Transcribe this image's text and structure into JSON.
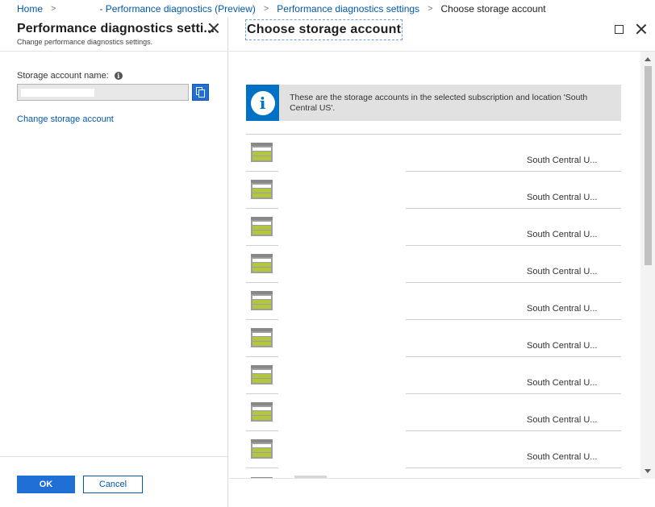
{
  "breadcrumb": {
    "home": "Home",
    "perf_diag": "- Performance diagnostics (Preview)",
    "perf_settings": "Performance diagnostics settings",
    "current": "Choose storage account"
  },
  "left_blade": {
    "title": "Performance diagnostics setti...",
    "subtitle": "Change performance diagnostics settings.",
    "field_label": "Storage account name:",
    "info_glyph": "i",
    "field_value": "",
    "change_link": "Change storage account",
    "ok_label": "OK",
    "cancel_label": "Cancel"
  },
  "right_blade": {
    "title": "Choose storage account",
    "info_glyph": "i",
    "info_message": "These are the storage accounts in the selected subscription and location 'South Central US'.",
    "rows": [
      {
        "name": "",
        "location": "South Central U..."
      },
      {
        "name": "",
        "location": "South Central U..."
      },
      {
        "name": "",
        "location": "South Central U..."
      },
      {
        "name": "",
        "location": "South Central U..."
      },
      {
        "name": "",
        "location": "South Central U..."
      },
      {
        "name": "",
        "location": "South Central U..."
      },
      {
        "name": "",
        "location": "South Central U..."
      },
      {
        "name": "",
        "location": "South Central U..."
      },
      {
        "name": "",
        "location": "South Central U..."
      }
    ]
  },
  "colors": {
    "accent": "#1f6fd6",
    "link": "#0058ad",
    "info_blue": "#0072c6",
    "storage_green": "#b3c63d"
  },
  "icons": {
    "breadcrumb_separator": "chevron-right-icon",
    "row_icon": "storage-account-icon"
  }
}
